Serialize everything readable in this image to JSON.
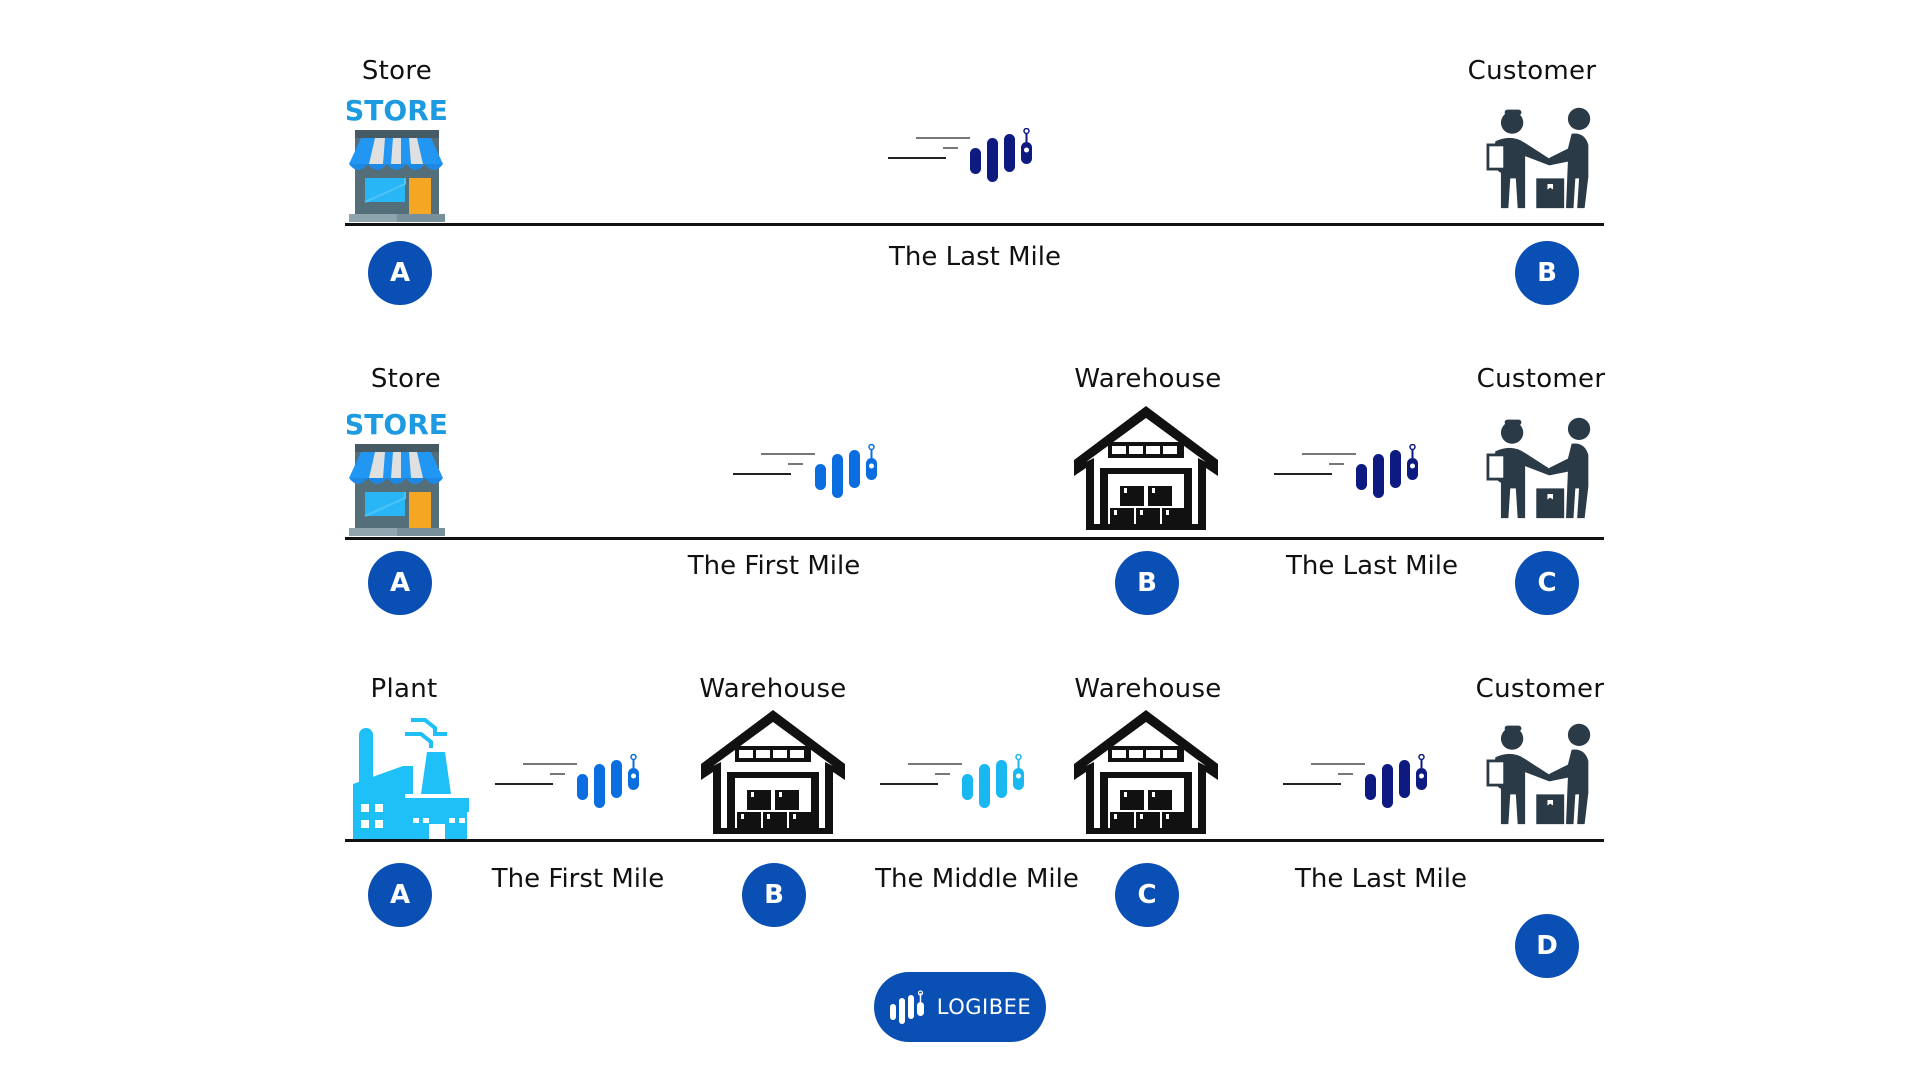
{
  "rows": [
    {
      "nodes": [
        {
          "label": "Store",
          "marker": "A",
          "icon": "store-icon"
        },
        {
          "label": "Customer",
          "marker": "B",
          "icon": "customer-handover-icon"
        }
      ],
      "segments": [
        {
          "label": "The Last Mile",
          "truck_color": "#0d1a80"
        }
      ]
    },
    {
      "nodes": [
        {
          "label": "Store",
          "marker": "A",
          "icon": "store-icon"
        },
        {
          "label": "Warehouse",
          "marker": "B",
          "icon": "warehouse-icon"
        },
        {
          "label": "Customer",
          "marker": "C",
          "icon": "customer-handover-icon"
        }
      ],
      "segments": [
        {
          "label": "The First Mile",
          "truck_color": "#0a6ee0"
        },
        {
          "label": "The Last Mile",
          "truck_color": "#0d1a80"
        }
      ]
    },
    {
      "nodes": [
        {
          "label": "Plant",
          "marker": "A",
          "icon": "factory-icon"
        },
        {
          "label": "Warehouse",
          "marker": "B",
          "icon": "warehouse-icon"
        },
        {
          "label": "Warehouse",
          "marker": "C",
          "icon": "warehouse-icon"
        },
        {
          "label": "Customer",
          "marker": "D",
          "icon": "customer-handover-icon"
        }
      ],
      "segments": [
        {
          "label": "The First Mile",
          "truck_color": "#0a6ee0"
        },
        {
          "label": "The Middle Mile",
          "truck_color": "#1ab8f0"
        },
        {
          "label": "The Last Mile",
          "truck_color": "#0d1a80"
        }
      ]
    }
  ],
  "store_sign": "STORE",
  "logo": {
    "text": "LOGIBEE"
  },
  "colors": {
    "marker": "#0a4fb3",
    "dark_navy": "#0d1a80",
    "blue": "#0a6ee0",
    "cyan": "#1ab8f0",
    "store_blue": "#1e9be0",
    "store_orange": "#f5a623",
    "figure": "#2b3a47"
  }
}
